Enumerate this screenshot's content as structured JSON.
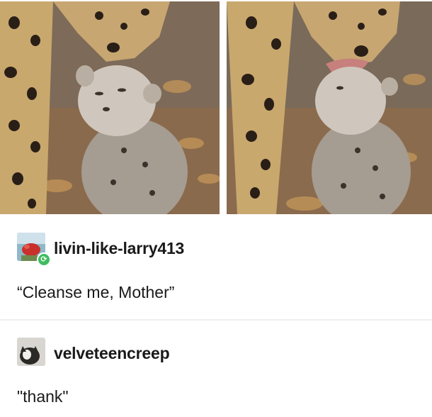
{
  "posts": [
    {
      "username": "livin-like-larry413",
      "text": "“Cleanse me, Mother”",
      "avatar_icon": "red-object-avatar-icon",
      "badge_icon": "reblog-icon",
      "badge_glyph": "⟳",
      "badge_color": "#3fbc5f"
    },
    {
      "username": "velveteencreep",
      "text": "\"thank\"",
      "avatar_icon": "cat-avatar-icon"
    }
  ],
  "photos": {
    "left_icon": "cheetah-cub-photo-icon",
    "right_icon": "cheetah-licking-cub-photo-icon"
  }
}
